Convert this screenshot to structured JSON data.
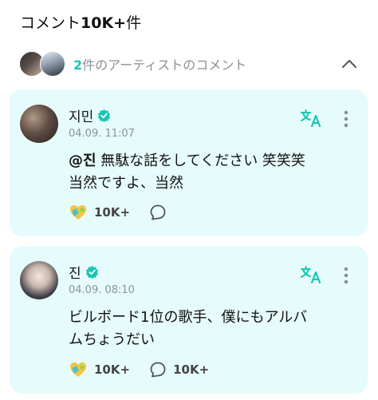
{
  "header": {
    "title_prefix": "コメント",
    "title_count": "10K+",
    "title_suffix": "件"
  },
  "artist_section": {
    "count": "2",
    "label": "件のアーティストのコメント"
  },
  "comments": [
    {
      "author": "지민",
      "timestamp": "04.09. 11:07",
      "mention": "@진",
      "text_line1": " 無駄な話をしてください 笑笑笑",
      "text_line2": "当然ですよ、当然",
      "likes": "10K+",
      "replies": ""
    },
    {
      "author": "진",
      "timestamp": "04.09. 08:10",
      "text_line1": "ビルボード1位の歌手、僕にもアルバ",
      "text_line2": "ムちょうだい",
      "likes": "10K+",
      "replies": "10K+"
    }
  ],
  "colors": {
    "accent": "#19c6b5",
    "card_bg": "#e6fbfb",
    "verified": "#19c6b5"
  },
  "icons": {
    "collapse": "chevron-up-icon",
    "verified": "verified-badge-icon",
    "translate": "translate-icon",
    "more": "more-vertical-icon",
    "like": "cheer-heart-icon",
    "reply": "comment-bubble-icon"
  }
}
